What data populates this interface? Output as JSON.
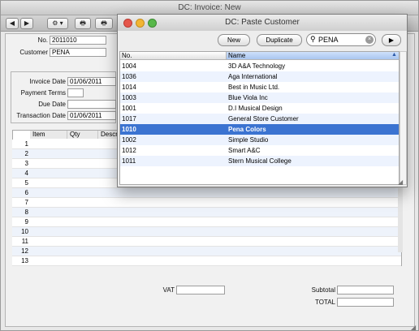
{
  "main_window": {
    "title": "DC: Invoice: New",
    "toolbar": {
      "back_label": "◀",
      "forward_label": "▶",
      "gear_label": "⚙",
      "print_label": "🖶",
      "preview_label": "🖶"
    },
    "header_fields": {
      "no_label": "No.",
      "no_value": "2011010",
      "customer_label": "Customer",
      "customer_value": "PENA"
    },
    "dates": {
      "invoice_date_label": "Invoice Date",
      "invoice_date_value": "01/06/2011",
      "payment_terms_label": "Payment Terms",
      "payment_terms_value": "",
      "due_date_label": "Due Date",
      "due_date_value": "",
      "transaction_date_label": "Transaction Date",
      "transaction_date_value": "01/06/2011"
    },
    "grid": {
      "columns": [
        "Item",
        "Qty",
        "Descr"
      ],
      "row_numbers": [
        "1",
        "2",
        "3",
        "4",
        "5",
        "6",
        "7",
        "8",
        "9",
        "10",
        "11",
        "12",
        "13"
      ]
    },
    "footer": {
      "vat_label": "VAT",
      "subtotal_label": "Subtotal",
      "total_label": "TOTAL"
    }
  },
  "paste_window": {
    "title": "DC: Paste Customer",
    "new_label": "New",
    "duplicate_label": "Duplicate",
    "search_value": "PENA",
    "columns": {
      "no": "No.",
      "name": "Name"
    },
    "rows": [
      {
        "no": "1004",
        "name": "3D A&A Technology"
      },
      {
        "no": "1036",
        "name": "Aga International"
      },
      {
        "no": "1014",
        "name": "Best in Music Ltd."
      },
      {
        "no": "1003",
        "name": "Blue Viola Inc"
      },
      {
        "no": "1001",
        "name": "D.I Musical Design"
      },
      {
        "no": "1017",
        "name": "General Store Customer"
      },
      {
        "no": "1010",
        "name": "Pena Colors"
      },
      {
        "no": "1002",
        "name": "Simple Studio"
      },
      {
        "no": "1012",
        "name": "Smart A&C"
      },
      {
        "no": "1011",
        "name": "Stern Musical College"
      }
    ],
    "selected_index": 6
  }
}
